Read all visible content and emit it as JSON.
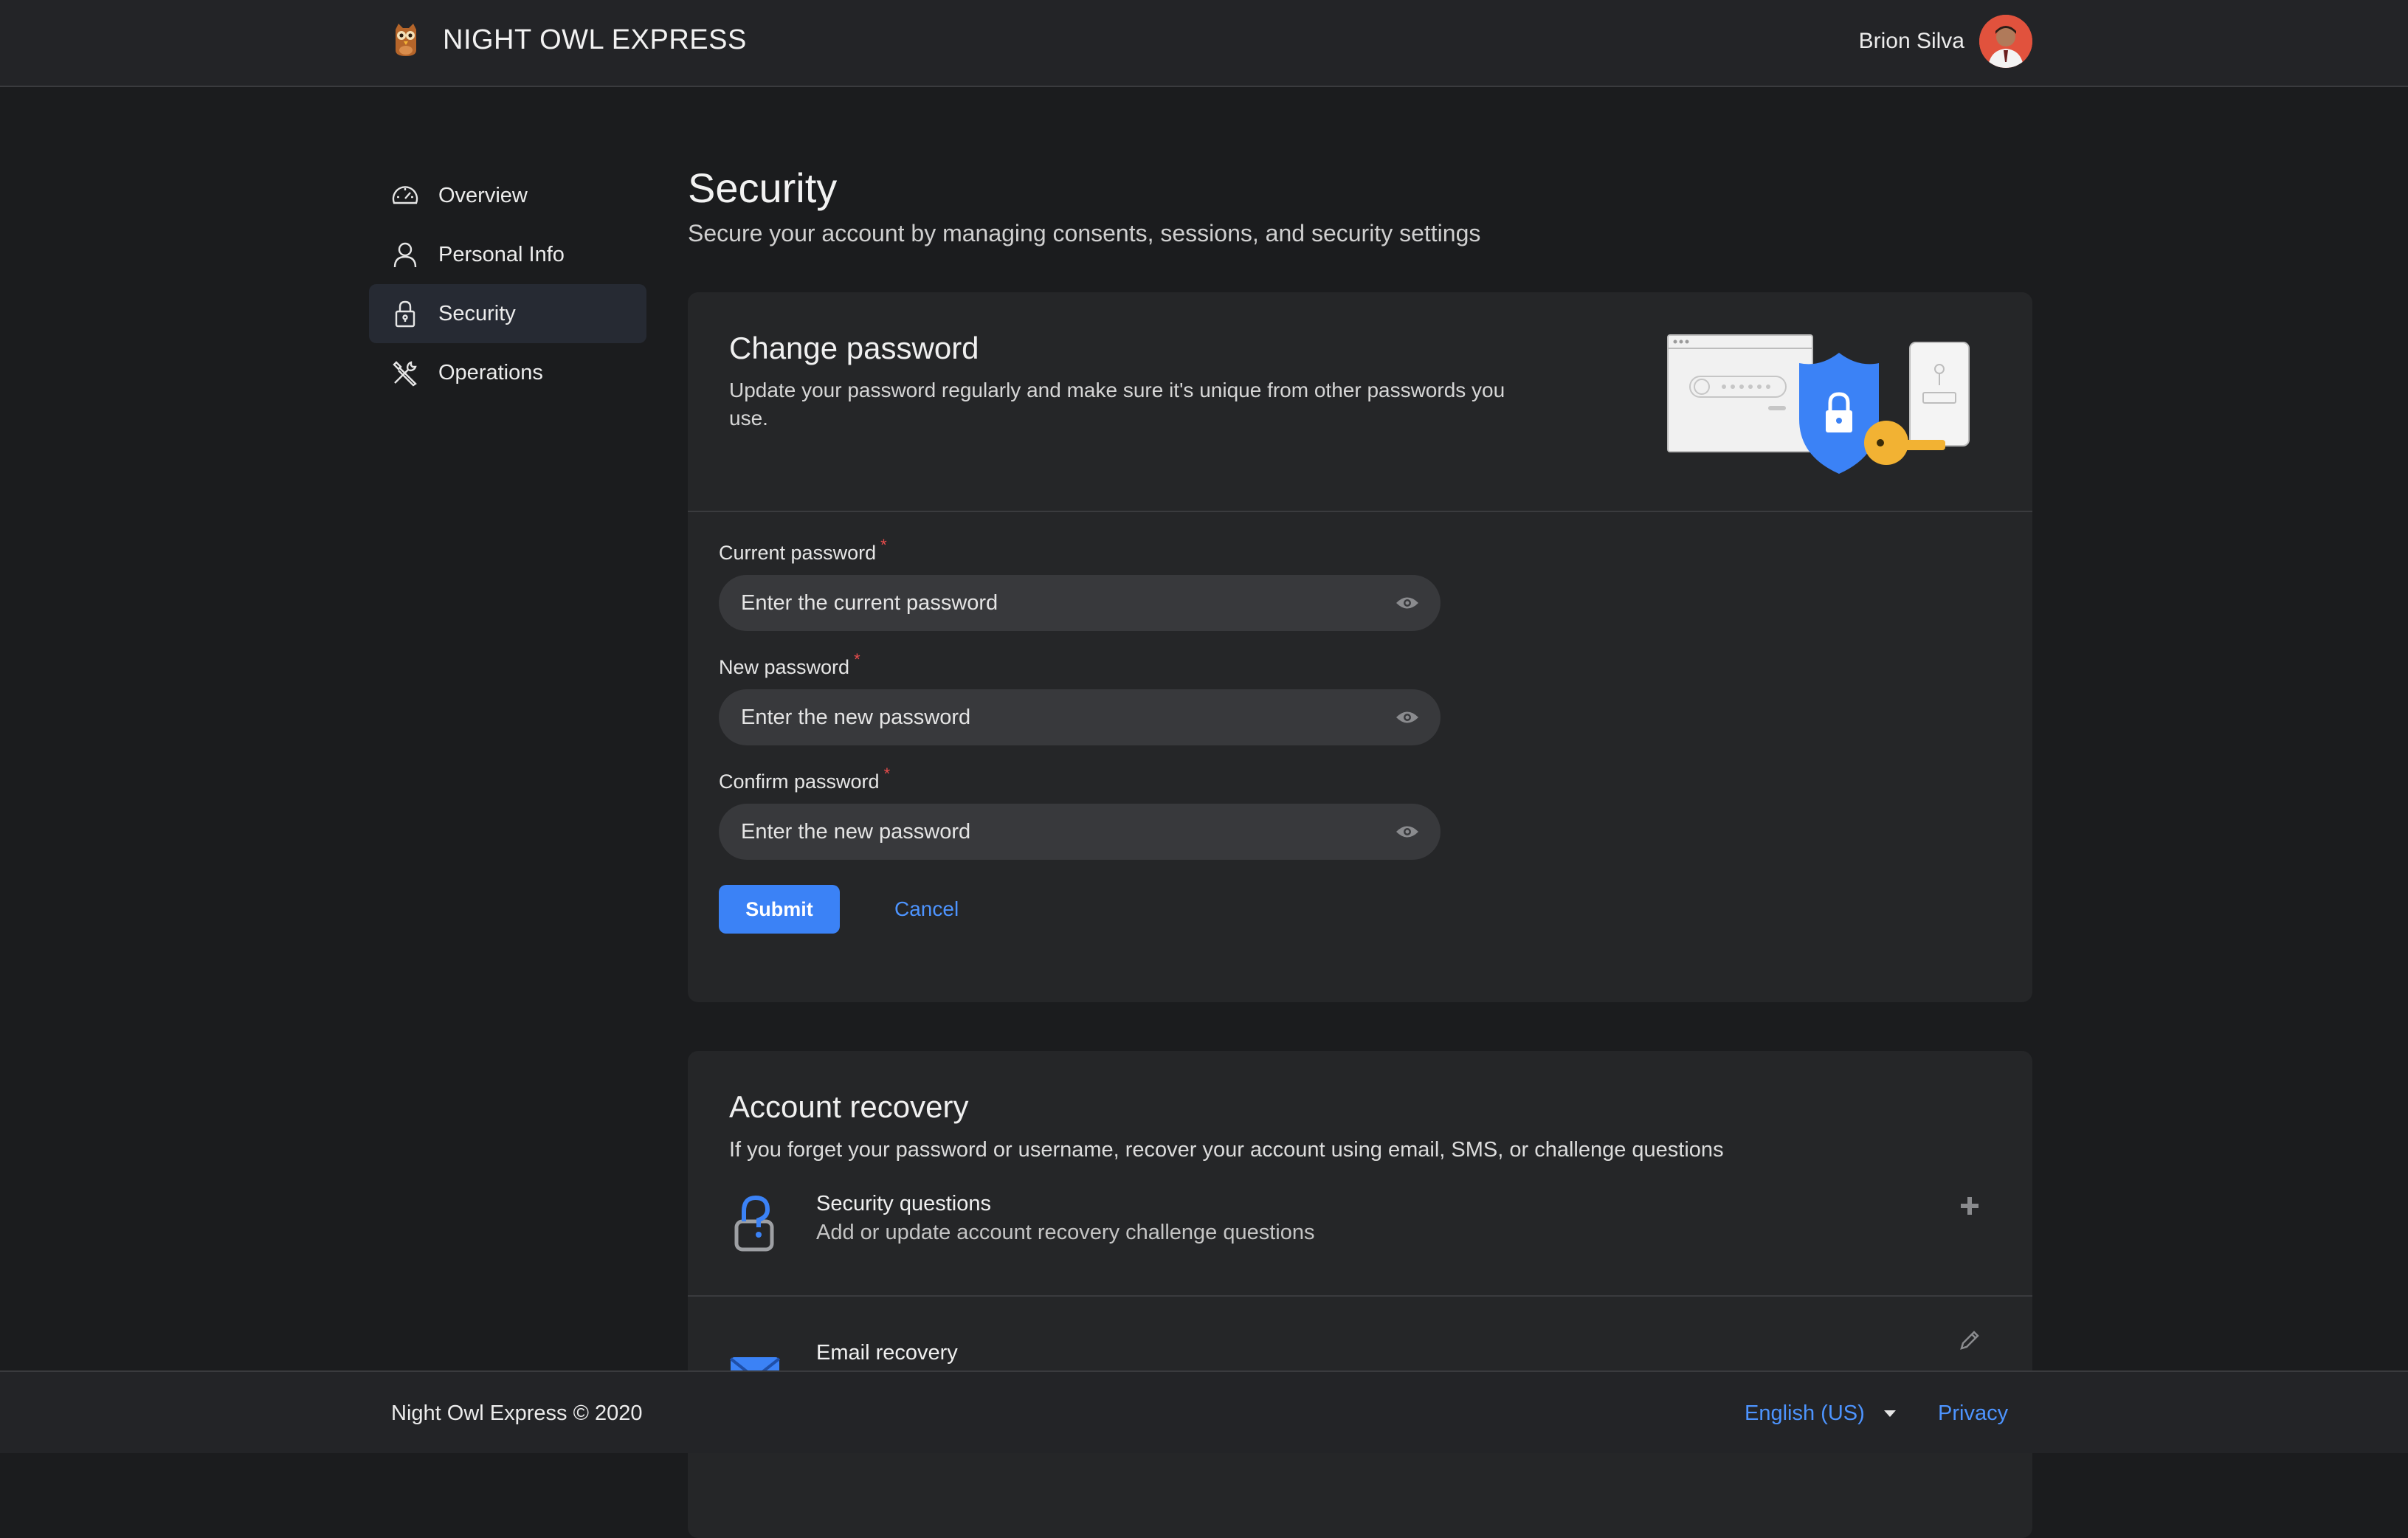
{
  "header": {
    "brand": "NIGHT OWL EXPRESS",
    "user_name": "Brion Silva"
  },
  "sidebar": {
    "items": [
      {
        "label": "Overview",
        "icon": "gauge-icon",
        "active": false
      },
      {
        "label": "Personal Info",
        "icon": "person-icon",
        "active": false
      },
      {
        "label": "Security",
        "icon": "lock-icon",
        "active": true
      },
      {
        "label": "Operations",
        "icon": "tools-icon",
        "active": false
      }
    ]
  },
  "page": {
    "title": "Security",
    "subtitle": "Secure your account by managing consents, sessions, and security settings"
  },
  "change_password": {
    "title": "Change password",
    "description": "Update your password regularly and make sure it's unique from other passwords you use.",
    "fields": [
      {
        "label": "Current password",
        "placeholder": "Enter the current password",
        "required": "*"
      },
      {
        "label": "New password",
        "placeholder": "Enter the new password",
        "required": "*"
      },
      {
        "label": "Confirm password",
        "placeholder": "Enter the new password",
        "required": "*"
      }
    ],
    "submit_label": "Submit",
    "cancel_label": "Cancel"
  },
  "account_recovery": {
    "title": "Account recovery",
    "description": "If you forget your password or username, recover your account using email, SMS, or challenge questions",
    "items": [
      {
        "title": "Security questions",
        "subtitle": "Add or update account recovery challenge questions",
        "action_icon": "plus-icon"
      },
      {
        "title": "Email recovery",
        "subtitle": "",
        "action_icon": "pencil-icon"
      }
    ]
  },
  "footer": {
    "copyright": "Night Owl Express © 2020",
    "language": "English (US)",
    "privacy": "Privacy"
  },
  "colors": {
    "accent": "#3b82f6",
    "link": "#4d94ff",
    "required": "#e84c4c",
    "illustration_gold": "#f2b233"
  }
}
